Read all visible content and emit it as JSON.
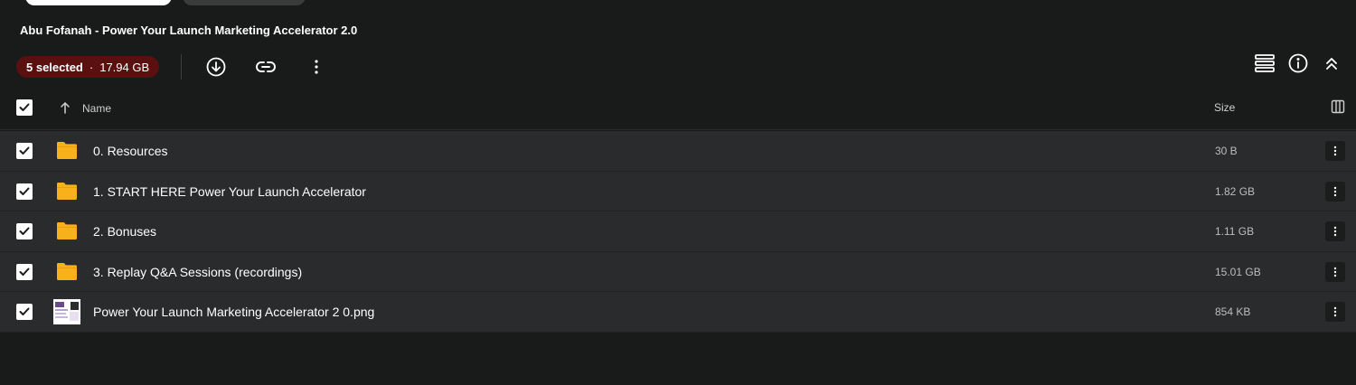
{
  "folder": {
    "title": "Abu Fofanah - Power Your Launch Marketing Accelerator 2.0"
  },
  "selection": {
    "count_label": "5 selected",
    "separator": "·",
    "size_label": "17.94 GB"
  },
  "table": {
    "name_header": "Name",
    "size_header": "Size"
  },
  "rows": [
    {
      "type": "folder",
      "name": "0. Resources",
      "size": "30 B",
      "checked": true
    },
    {
      "type": "folder",
      "name": "1. START HERE Power Your Launch Accelerator",
      "size": "1.82 GB",
      "checked": true
    },
    {
      "type": "folder",
      "name": "2. Bonuses",
      "size": "1.11 GB",
      "checked": true
    },
    {
      "type": "folder",
      "name": "3. Replay Q&A Sessions (recordings)",
      "size": "15.01 GB",
      "checked": true
    },
    {
      "type": "image",
      "name": "Power Your Launch Marketing Accelerator 2 0.png",
      "size": "854 KB",
      "checked": true
    }
  ],
  "colors": {
    "badge_bg": "#5b1010",
    "folder_icon": "#f9b11b",
    "background": "#191a1a",
    "row_bg": "#2a2b2c"
  },
  "icons": [
    "download-icon",
    "link-icon",
    "more-vertical-icon",
    "list-view-icon",
    "info-icon",
    "collapse-up-icon",
    "sort-up-arrow-icon",
    "column-settings-icon",
    "folder-icon",
    "checkmark-icon"
  ]
}
